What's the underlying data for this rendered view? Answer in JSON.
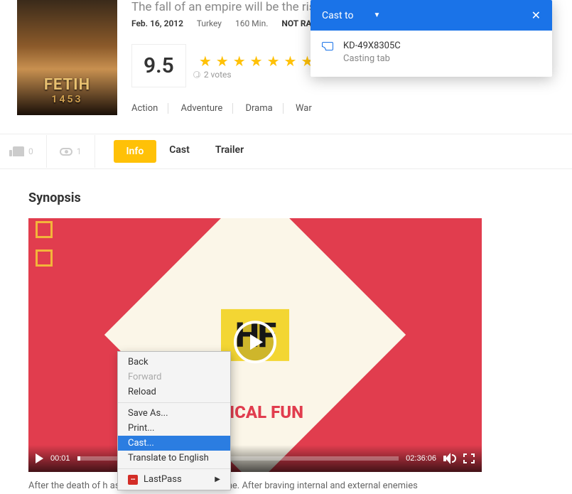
{
  "movie": {
    "poster_title": "FETIH",
    "poster_year": "1453",
    "tagline": "The fall of an empire will be the rise...",
    "release_date": "Feb. 16, 2012",
    "country": "Turkey",
    "runtime": "160 Min.",
    "rating_cert": "NOT RA",
    "score": "9.5",
    "votes_count": "2 votes",
    "genres": [
      "Action",
      "Adventure",
      "Drama",
      "War"
    ]
  },
  "engagement": {
    "likes": "0",
    "views": "1"
  },
  "tabs": [
    "Info",
    "Cast",
    "Trailer"
  ],
  "section_title": "Synopsis",
  "video": {
    "logo_text": "HF",
    "brand_text": "ORICAL FUN",
    "current_time": "00:01",
    "duration": "02:36:06"
  },
  "synopsis_text": "After the death of h                                              ascends to the Ottoman throne. After braving internal and external enemies",
  "context_menu": {
    "back": "Back",
    "forward": "Forward",
    "reload": "Reload",
    "save_as": "Save As...",
    "print": "Print...",
    "cast": "Cast...",
    "translate": "Translate to English",
    "lastpass": "LastPass"
  },
  "cast_popup": {
    "title": "Cast to",
    "device_name": "KD-49X8305C",
    "device_status": "Casting tab"
  }
}
